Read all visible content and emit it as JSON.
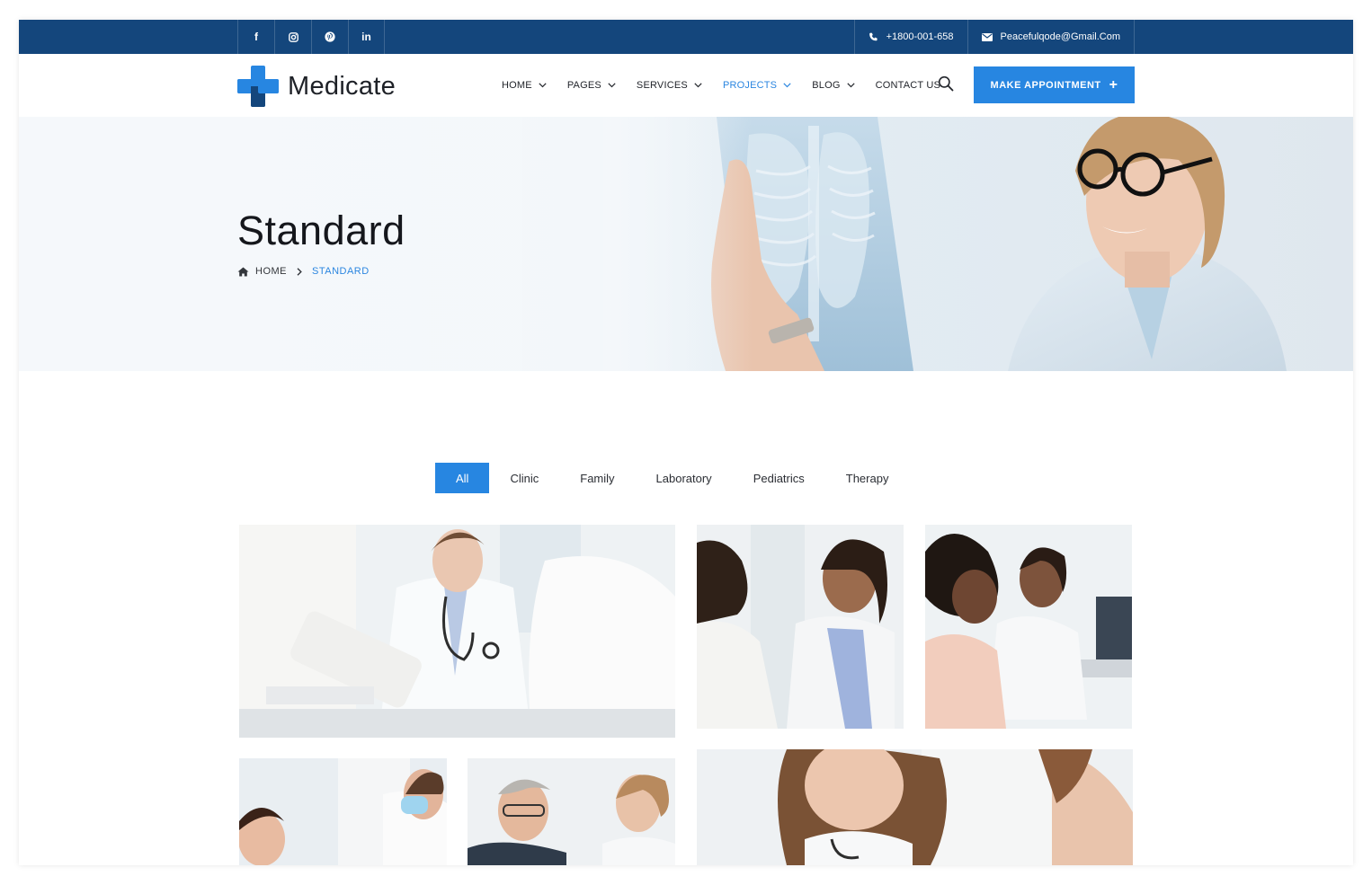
{
  "topbar": {
    "socials": [
      {
        "icon": "facebook-icon",
        "glyph": "f"
      },
      {
        "icon": "instagram-icon",
        "glyph": ""
      },
      {
        "icon": "pinterest-icon",
        "glyph": ""
      },
      {
        "icon": "linkedin-icon",
        "glyph": "in"
      }
    ],
    "phone": "+1800-001-658",
    "email": "Peacefulqode@Gmail.Com"
  },
  "header": {
    "logo_text": "Medicate",
    "nav": [
      {
        "label": "HOME",
        "has_dropdown": true,
        "active": false
      },
      {
        "label": "PAGES",
        "has_dropdown": true,
        "active": false
      },
      {
        "label": "SERVICES",
        "has_dropdown": true,
        "active": false
      },
      {
        "label": "PROJECTS",
        "has_dropdown": true,
        "active": true
      },
      {
        "label": "BLOG",
        "has_dropdown": true,
        "active": false
      },
      {
        "label": "CONTACT US",
        "has_dropdown": false,
        "active": false
      }
    ],
    "cta_label": "MAKE APPOINTMENT",
    "cta_icon": "+"
  },
  "hero": {
    "title": "Standard",
    "breadcrumb_home": "HOME",
    "breadcrumb_current": "STANDARD"
  },
  "filters": [
    {
      "label": "All",
      "active": true
    },
    {
      "label": "Clinic",
      "active": false
    },
    {
      "label": "Family",
      "active": false
    },
    {
      "label": "Laboratory",
      "active": false
    },
    {
      "label": "Pediatrics",
      "active": false
    },
    {
      "label": "Therapy",
      "active": false
    }
  ],
  "colors": {
    "topbar": "#14467c",
    "accent": "#2786e1",
    "active_text": "#2b86e0"
  }
}
